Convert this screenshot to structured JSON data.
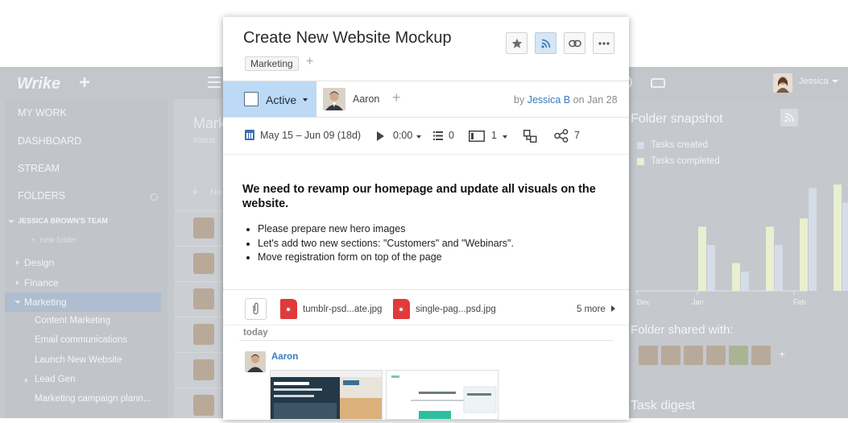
{
  "app": {
    "logo": "Wrike",
    "user": "Jessica",
    "sidebar": {
      "items": [
        "MY WORK",
        "DASHBOARD",
        "STREAM",
        "FOLDERS"
      ],
      "team": "JESSICA BROWN'S TEAM",
      "new_folder": "new folder",
      "folders": [
        "Design",
        "Finance",
        "Marketing"
      ],
      "subfolders": [
        "Content Marketing",
        "Email communications",
        "Launch New Website",
        "Lead Gen",
        "Marketing campaign plann..."
      ]
    },
    "tasklist": {
      "title": "Mark",
      "status": "status:",
      "new_task": "Ne"
    },
    "snapshot": {
      "title": "Folder snapshot",
      "legend": [
        "Tasks created",
        "Tasks completed"
      ],
      "shared_title": "Folder shared with:",
      "digest_title": "Task digest"
    }
  },
  "chart_data": {
    "type": "bar",
    "categories": [
      "",
      "",
      "",
      "",
      ""
    ],
    "series": [
      {
        "name": "Tasks created",
        "color": "#d6dce8",
        "values": [
          38,
          16,
          38,
          85,
          73
        ]
      },
      {
        "name": "Tasks completed",
        "color": "#e9efcf",
        "values": [
          53,
          23,
          53,
          60,
          88
        ]
      }
    ],
    "x_tick_labels": [
      "Dec",
      "Jan",
      "Feb"
    ],
    "ylim": [
      0,
      100
    ]
  },
  "task": {
    "title": "Create New Website Mockup",
    "tag": "Marketing",
    "status": "Active",
    "assignee": "Aaron",
    "author_prefix": "by",
    "author": "Jessica B",
    "created": "on Jan 28",
    "dates": "May 15 – Jun 09 (18d)",
    "time": "0:00",
    "subtasks": "0",
    "checklist": "1",
    "dependencies": "7",
    "description_heading": "We need to revamp our homepage and update all visuals on the website.",
    "bullets": [
      "Please prepare new hero images",
      "Let's add two new sections: \"Customers\" and \"Webinars\".",
      "Move registration form on top of the page"
    ],
    "attachments": [
      "tumblr-psd...ate.jpg",
      "single-pag...psd.jpg"
    ],
    "more_attachments": "5 more",
    "stream_day": "today",
    "comment_author": "Aaron"
  },
  "colors": {
    "accent": "#3a7bbd",
    "status_bg": "#bcd9f5",
    "file_red": "#e03a3a"
  }
}
